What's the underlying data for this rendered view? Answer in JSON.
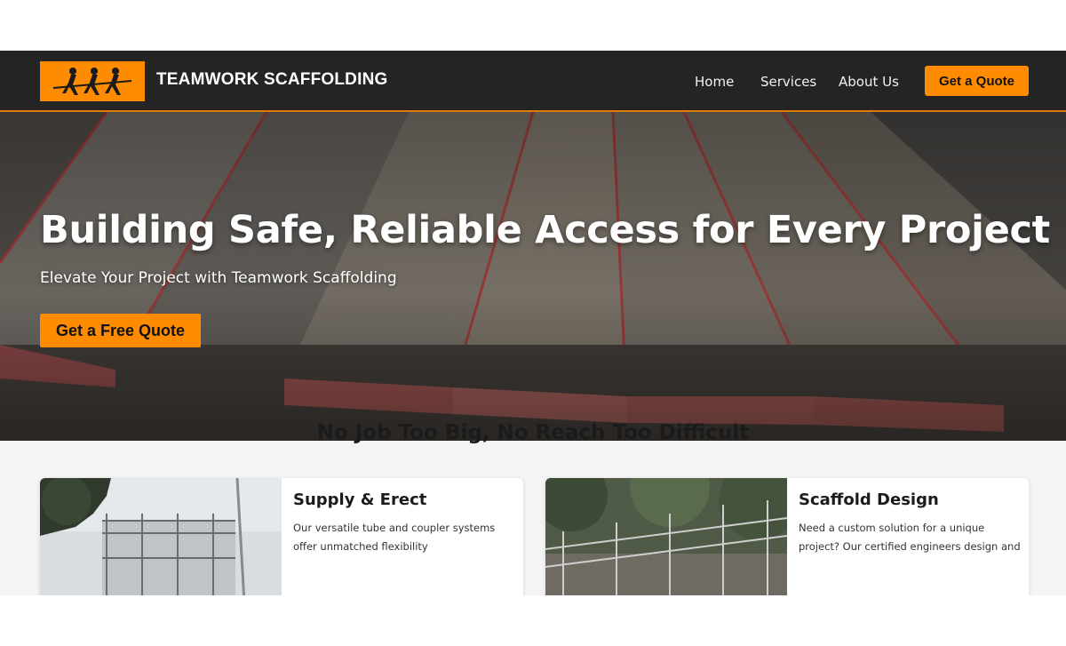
{
  "header": {
    "brand": "TEAMWORK SCAFFOLDING",
    "logo_icon": "workers-pulling-rope-icon",
    "nav": [
      "Home",
      "Services",
      "About Us"
    ],
    "cta": "Get a Quote"
  },
  "hero": {
    "title": "Building Safe, Reliable Access for Every Project",
    "subtitle": "Elevate Your Project with Teamwork Scaffolding",
    "cta": "Get a Free Quote"
  },
  "services": {
    "heading": "No Job Too Big, No Reach Too Difficult",
    "cards": [
      {
        "title": "Supply & Erect",
        "text": "Our versatile tube and coupler systems offer unmatched flexibility"
      },
      {
        "title": "Scaffold Design",
        "text": "Need a custom solution for a unique project? Our certified engineers design and"
      }
    ]
  },
  "colors": {
    "accent": "#ff8c00",
    "header_bg": "#242424",
    "section_bg": "#f4f4f4"
  }
}
